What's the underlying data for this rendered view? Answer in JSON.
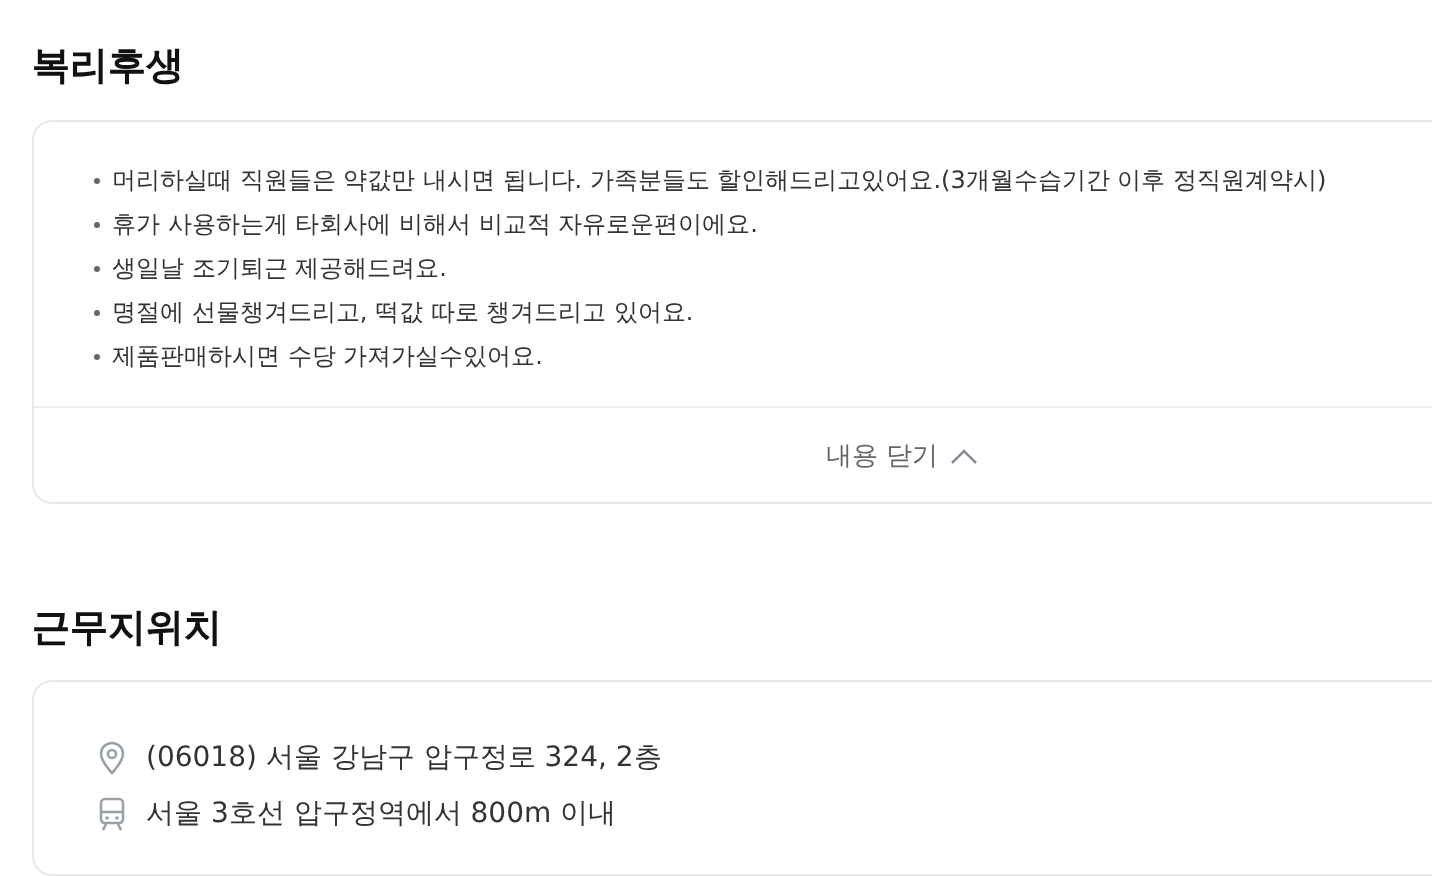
{
  "sections": [
    {
      "kind": "benefits",
      "title": "복리후생",
      "expanded": true,
      "toggle_label": "내용 닫기",
      "items": [
        "머리하실때 직원들은 약값만 내시면 됩니다. 가족분들도 할인해드리고있어요.(3개월수습기간 이후 정직원계약시)",
        "휴가 사용하는게 타회사에 비해서 비교적 자유로운편이에요.",
        "생일날 조기퇴근 제공해드려요.",
        "명절에 선물챙겨드리고, 떡값 따로 챙겨드리고 있어요.",
        "제품판매하시면 수당 가져가실수있어요."
      ]
    },
    {
      "kind": "location",
      "title": "근무지위치",
      "lines": [
        {
          "kind": "address",
          "text": "(06018) 서울 강남구 압구정로 324, 2층"
        },
        {
          "kind": "subway",
          "text": "서울 3호선 압구정역에서 800m 이내"
        }
      ]
    }
  ]
}
